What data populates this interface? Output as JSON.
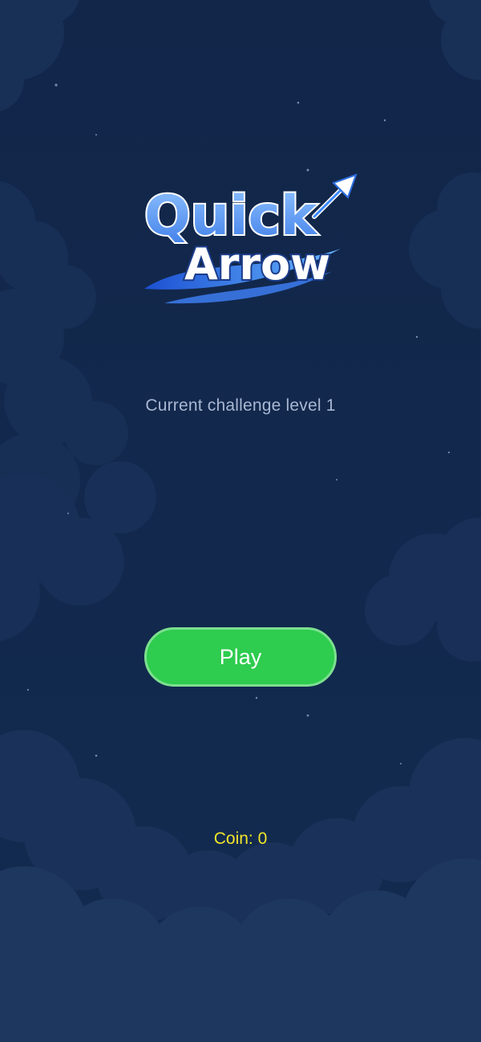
{
  "colors": {
    "background": "#112548",
    "cloud": "#1b355f",
    "play_button": "#2ecc4f",
    "coin_text": "#f1e52a",
    "level_text": "#a9b7d3"
  },
  "logo": {
    "line1": "Quick",
    "line2": "Arrow",
    "icon": "arrow-icon"
  },
  "challenge": {
    "text": "Current challenge level 1"
  },
  "play_button": {
    "label": "Play"
  },
  "coin": {
    "text": "Coin: 0"
  }
}
